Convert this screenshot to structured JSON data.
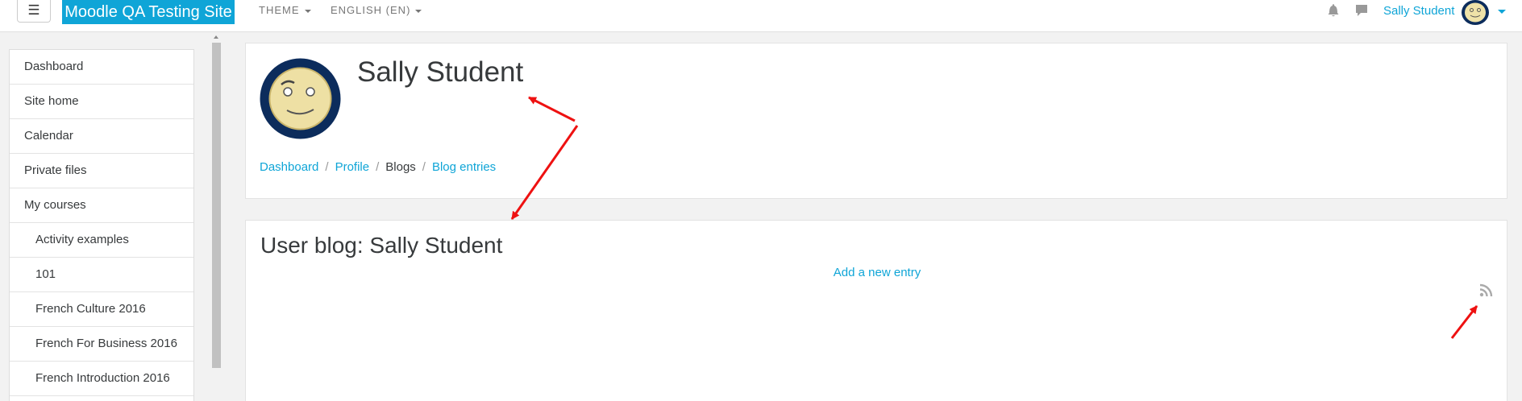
{
  "navbar": {
    "menu_toggle": "☰",
    "site_name": "Moodle QA Testing Site",
    "theme_menu": "THEME",
    "language_menu": "ENGLISH (EN)",
    "user_name": "Sally Student"
  },
  "sidebar": {
    "items": [
      {
        "label": "Dashboard"
      },
      {
        "label": "Site home"
      },
      {
        "label": "Calendar"
      },
      {
        "label": "Private files"
      },
      {
        "label": "My courses"
      },
      {
        "label": "Activity examples"
      },
      {
        "label": "101"
      },
      {
        "label": "French Culture 2016"
      },
      {
        "label": "French For Business 2016"
      },
      {
        "label": "French Introduction 2016"
      }
    ]
  },
  "header": {
    "title": "Sally Student",
    "breadcrumb": {
      "items": [
        "Dashboard",
        "Profile",
        "Blogs",
        "Blog entries"
      ],
      "separator": "/"
    }
  },
  "main": {
    "heading": "User blog: Sally Student",
    "add_entry_link": "Add a new entry"
  },
  "icons": {
    "notifications": "bell-icon",
    "messages": "chat-bubble-icon",
    "rss": "rss-icon"
  },
  "colors": {
    "brand": "#0fa5d7",
    "link": "#0fa5d7",
    "annotation_arrow": "#ee1111"
  }
}
